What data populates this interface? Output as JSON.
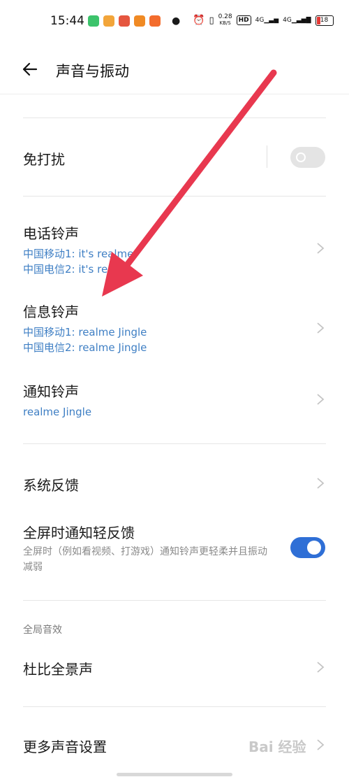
{
  "status_bar": {
    "time": "15:44",
    "net_rate_value": "0.28",
    "net_rate_unit": "KB/S",
    "hd_badge": "HD",
    "sim1_type": "4G",
    "sim2_type": "4G",
    "battery_level": "18"
  },
  "header": {
    "title": "声音与振动"
  },
  "settings": {
    "dnd": {
      "label": "免打扰",
      "enabled": false
    },
    "phone_ringtone": {
      "label": "电话铃声",
      "sim1": "中国移动1: it's realme",
      "sim2": "中国电信2: it's realme"
    },
    "message_ringtone": {
      "label": "信息铃声",
      "sim1": "中国移动1: realme Jingle",
      "sim2": "中国电信2: realme Jingle"
    },
    "notification_ringtone": {
      "label": "通知铃声",
      "value": "realme Jingle"
    },
    "system_feedback": {
      "label": "系统反馈"
    },
    "fullscreen_feedback": {
      "label": "全屏时通知轻反馈",
      "description": "全屏时（例如看视频、打游戏）通知铃声更轻柔并且振动减弱",
      "enabled": true
    },
    "global_effects_section": "全局音效",
    "dolby": {
      "label": "杜比全景声"
    },
    "more_sound": {
      "label": "更多声音设置"
    }
  },
  "watermark": "Bai 经验",
  "colors": {
    "accent": "#2f6fd6",
    "subtext_blue": "#3f7fc4",
    "annotation_arrow": "#e8384f"
  }
}
